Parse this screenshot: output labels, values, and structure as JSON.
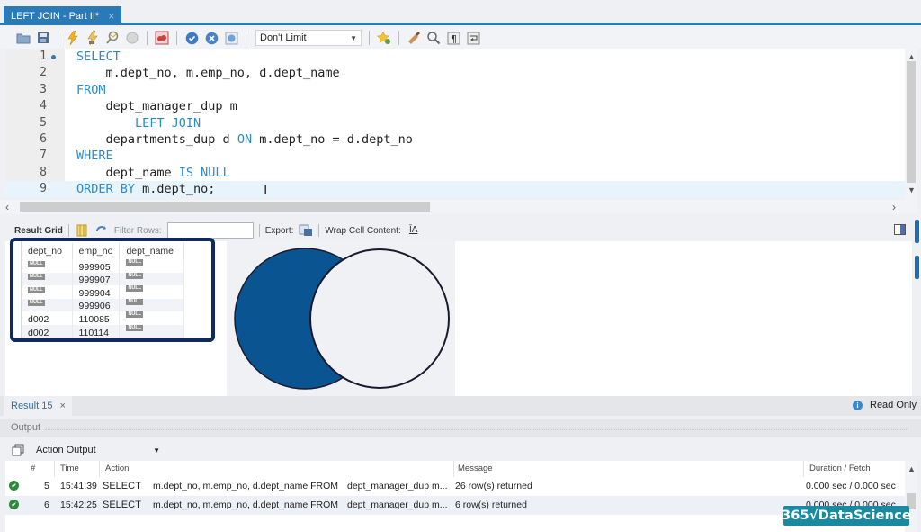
{
  "tab": {
    "title": "LEFT JOIN - Part II*",
    "close": "×"
  },
  "toolbar": {
    "limit_value": "Don't Limit",
    "icons": [
      "open-folder-icon",
      "save-icon",
      "execute-icon",
      "execute-current-icon",
      "explain-icon",
      "stop-icon",
      "toggle-error-icon",
      "commit-icon",
      "rollback-icon",
      "autocommit-icon",
      "limit-select",
      "bookmark-icon",
      "beautify-icon",
      "find-icon",
      "invisible-chars-icon",
      "wrap-icon"
    ]
  },
  "editor": {
    "lines": [
      {
        "n": "1",
        "parts": [
          {
            "t": "SELECT",
            "kw": true
          }
        ]
      },
      {
        "n": "2",
        "parts": [
          {
            "t": "    m.dept_no, m.emp_no, d.dept_name",
            "kw": false
          }
        ]
      },
      {
        "n": "3",
        "parts": [
          {
            "t": "FROM",
            "kw": true
          }
        ]
      },
      {
        "n": "4",
        "parts": [
          {
            "t": "    dept_manager_dup m",
            "kw": false
          }
        ]
      },
      {
        "n": "5",
        "parts": [
          {
            "t": "        LEFT JOIN",
            "kw": true
          }
        ]
      },
      {
        "n": "6",
        "parts": [
          {
            "t": "    departments_dup d ",
            "kw": false
          },
          {
            "t": "ON",
            "kw": true
          },
          {
            "t": " m.dept_no = d.dept_no",
            "kw": false
          }
        ]
      },
      {
        "n": "7",
        "parts": [
          {
            "t": "WHERE",
            "kw": true
          }
        ]
      },
      {
        "n": "8",
        "parts": [
          {
            "t": "    dept_name ",
            "kw": false
          },
          {
            "t": "IS NULL",
            "kw": true
          }
        ]
      },
      {
        "n": "9",
        "parts": [
          {
            "t": "ORDER BY",
            "kw": true
          },
          {
            "t": " m.dept_no;",
            "kw": false
          }
        ]
      }
    ],
    "cursor_glyph": "I"
  },
  "results_toolbar": {
    "result_grid": "Result Grid",
    "filter_rows": "Filter Rows:",
    "filter_value": "",
    "export": "Export:",
    "wrap": "Wrap Cell Content:",
    "wrap_icon": "ĪA"
  },
  "grid": {
    "columns": [
      "dept_no",
      "emp_no",
      "dept_name"
    ],
    "null_label": "NULL",
    "rows": [
      [
        null,
        "999905",
        null
      ],
      [
        null,
        "999907",
        null
      ],
      [
        null,
        "999904",
        null
      ],
      [
        null,
        "999906",
        null
      ],
      [
        "d002",
        "110085",
        null
      ],
      [
        "d002",
        "110114",
        null
      ]
    ]
  },
  "venn": {
    "left_fill": "#0a5591",
    "right_fill": "#f0f1f4",
    "stroke": "#1a1a2e"
  },
  "result_tab": {
    "label": "Result 15",
    "close": "×"
  },
  "read_only": "Read Only",
  "output": {
    "header": "Output",
    "mode": "Action Output",
    "columns": [
      "#",
      "Time",
      "Action",
      "Message",
      "Duration / Fetch"
    ],
    "rows": [
      {
        "num": "5",
        "time": "15:41:39",
        "verb": "SELECT",
        "action": "m.dept_no, m.emp_no, d.dept_name FROM",
        "action2": "dept_manager_dup m...",
        "message": "26 row(s) returned",
        "duration": "0.000 sec / 0.000 sec"
      },
      {
        "num": "6",
        "time": "15:42:25",
        "verb": "SELECT",
        "action": "m.dept_no, m.emp_no, d.dept_name FROM",
        "action2": "dept_manager_dup m...",
        "message": "6 row(s) returned",
        "duration": "0.000 sec / 0.000 sec"
      }
    ]
  },
  "watermark": "365√DataScience"
}
